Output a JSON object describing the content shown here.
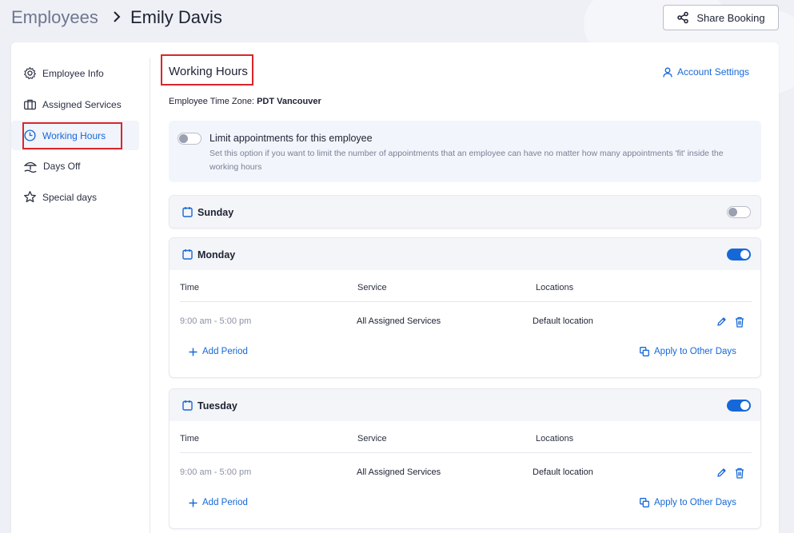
{
  "header": {
    "breadcrumb_root": "Employees",
    "breadcrumb_current": "Emily Davis",
    "share_label": "Share Booking"
  },
  "sidebar": {
    "items": [
      {
        "label": "Employee Info",
        "icon": "gear-icon",
        "active": false
      },
      {
        "label": "Assigned Services",
        "icon": "briefcase-icon",
        "active": false
      },
      {
        "label": "Working Hours",
        "icon": "clock-icon",
        "active": true
      },
      {
        "label": "Days Off",
        "icon": "beach-umbrella-icon",
        "active": false
      },
      {
        "label": "Special days",
        "icon": "star-icon",
        "active": false
      }
    ]
  },
  "main": {
    "title": "Working Hours",
    "account_settings": "Account Settings",
    "timezone_label": "Employee Time Zone:",
    "timezone_value": "PDT Vancouver",
    "limit": {
      "enabled": false,
      "title": "Limit appointments for this employee",
      "description": "Set this option if you want to limit the number of appointments that an employee can have no matter how many appointments 'fit' inside the working hours"
    },
    "columns": {
      "time": "Time",
      "service": "Service",
      "locations": "Locations"
    },
    "add_period": "Add Period",
    "apply_other_days": "Apply to Other Days",
    "days": [
      {
        "name": "Sunday",
        "enabled": false
      },
      {
        "name": "Monday",
        "enabled": true,
        "period": {
          "time": "9:00 am - 5:00 pm",
          "service": "All Assigned Services",
          "location": "Default location"
        }
      },
      {
        "name": "Tuesday",
        "enabled": true,
        "period": {
          "time": "9:00 am - 5:00 pm",
          "service": "All Assigned Services",
          "location": "Default location"
        }
      }
    ]
  },
  "colors": {
    "accent": "#1668d8",
    "highlight": "#d9262c"
  }
}
